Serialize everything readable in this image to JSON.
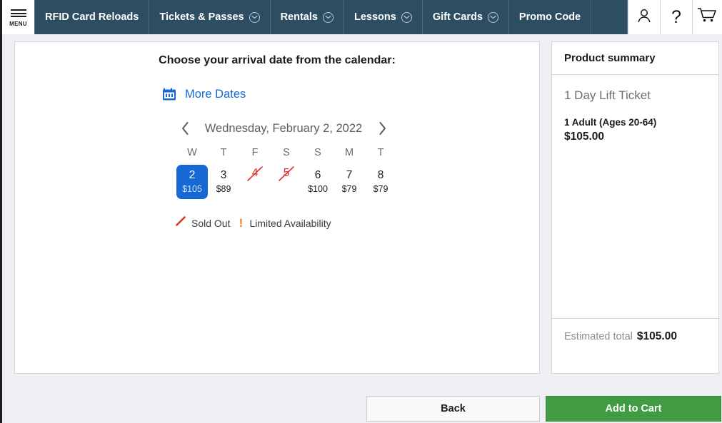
{
  "navbar": {
    "menu_label": "MENU",
    "items": [
      {
        "label": "RFID Card Reloads",
        "has_dropdown": false
      },
      {
        "label": "Tickets & Passes",
        "has_dropdown": true
      },
      {
        "label": "Rentals",
        "has_dropdown": true
      },
      {
        "label": "Lessons",
        "has_dropdown": true
      },
      {
        "label": "Gift Cards",
        "has_dropdown": true
      },
      {
        "label": "Promo Code",
        "has_dropdown": false
      }
    ],
    "icons": [
      {
        "name": "account-icon",
        "glyph": "person"
      },
      {
        "name": "help-icon",
        "glyph": "?"
      },
      {
        "name": "cart-icon",
        "glyph": "cart"
      }
    ],
    "background_color": "#2d4d63"
  },
  "main": {
    "title": "Choose your arrival date from the calendar:",
    "more_dates_label": "More Dates",
    "date_nav": {
      "prev_label": "‹",
      "next_label": "›",
      "current_date": "Wednesday, February 2, 2022"
    },
    "calendar": {
      "days": [
        {
          "dow": "W",
          "day": "2",
          "price": "$105",
          "state": "selected"
        },
        {
          "dow": "T",
          "day": "3",
          "price": "$89",
          "state": "available"
        },
        {
          "dow": "F",
          "day": "4",
          "price": "",
          "state": "soldout"
        },
        {
          "dow": "S",
          "day": "5",
          "price": "",
          "state": "soldout"
        },
        {
          "dow": "S",
          "day": "6",
          "price": "$100",
          "state": "available"
        },
        {
          "dow": "M",
          "day": "7",
          "price": "$79",
          "state": "available"
        },
        {
          "dow": "T",
          "day": "8",
          "price": "$79",
          "state": "available"
        }
      ],
      "selected_color": "#1668d4",
      "soldout_color": "#e0302b",
      "limited_color": "#e8832a"
    },
    "legend": {
      "sold_out_label": "Sold Out",
      "limited_label": "Limited Availability"
    }
  },
  "summary": {
    "heading": "Product summary",
    "product_name": "1 Day Lift Ticket",
    "quantity_line": "1 Adult (Ages 20-64)",
    "line_price": "$105.00",
    "total_label": "Estimated total",
    "total_value": "$105.00"
  },
  "footer": {
    "back_label": "Back",
    "add_to_cart_label": "Add to Cart",
    "add_to_cart_color": "#419b42"
  }
}
